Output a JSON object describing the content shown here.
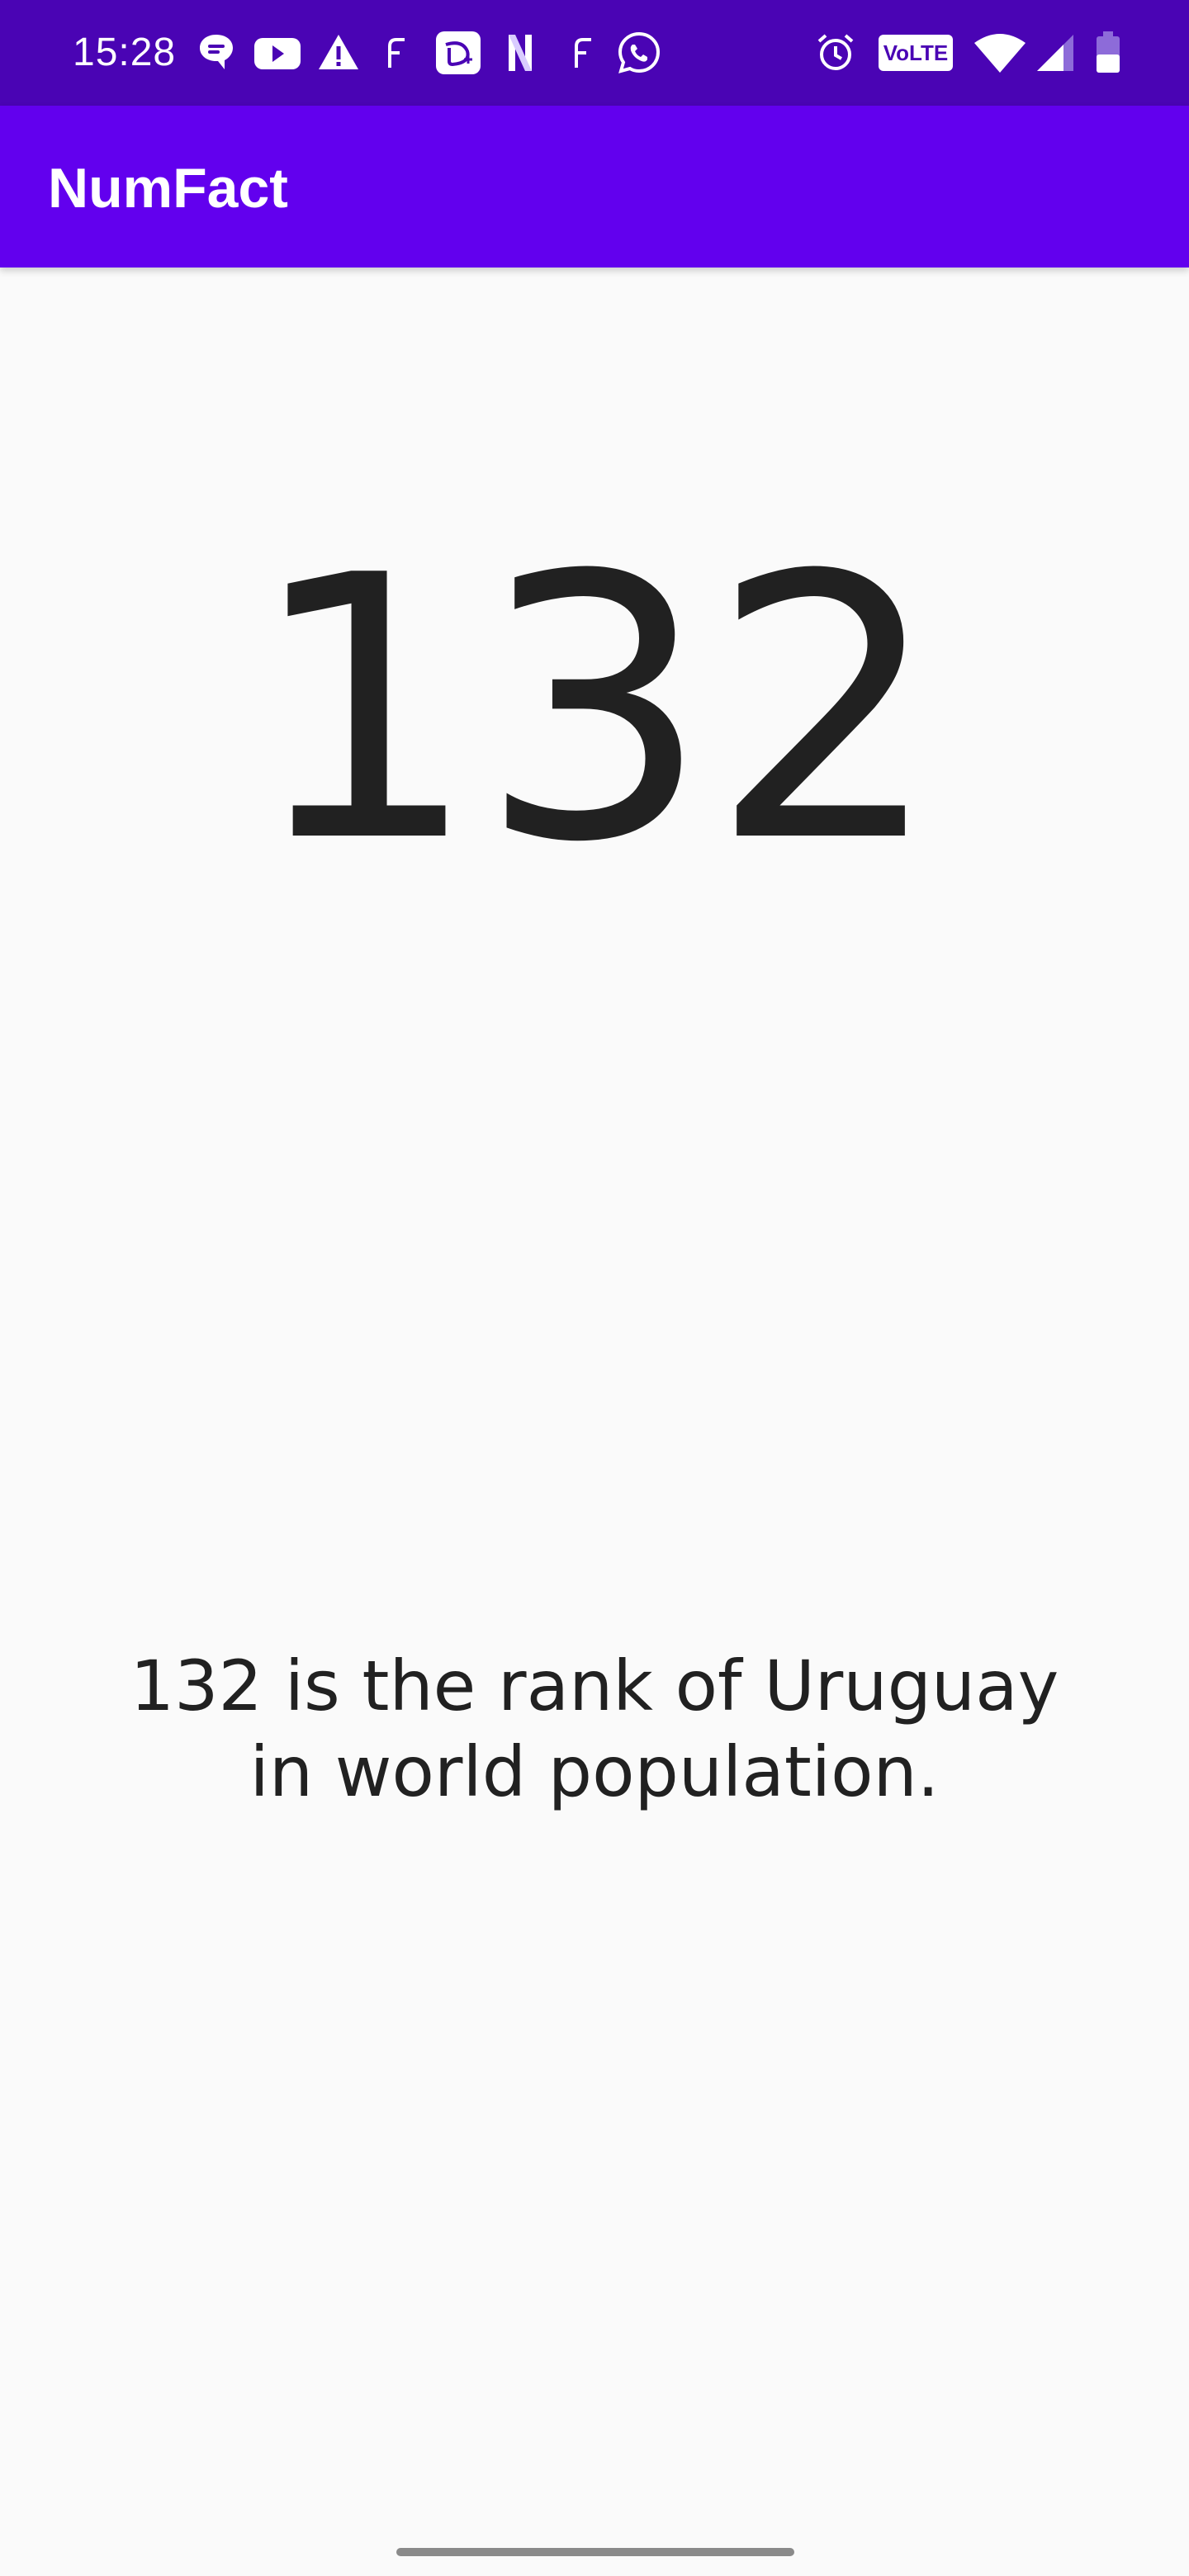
{
  "status_bar": {
    "time": "15:28",
    "volte_label": "VoLTE",
    "background_color": "#4a04b4",
    "notification_icons": [
      "message-icon",
      "youtube-icon",
      "warning-icon",
      "f-icon",
      "disney-plus-icon",
      "netflix-icon",
      "f-icon",
      "whatsapp-icon"
    ],
    "system_icons": [
      "alarm-icon",
      "volte-icon",
      "wifi-icon",
      "signal-icon",
      "battery-icon"
    ]
  },
  "app_bar": {
    "title": "NumFact",
    "background_color": "#6200ee"
  },
  "main": {
    "number": "132",
    "fact": "132 is the rank of Uruguay in world population."
  }
}
